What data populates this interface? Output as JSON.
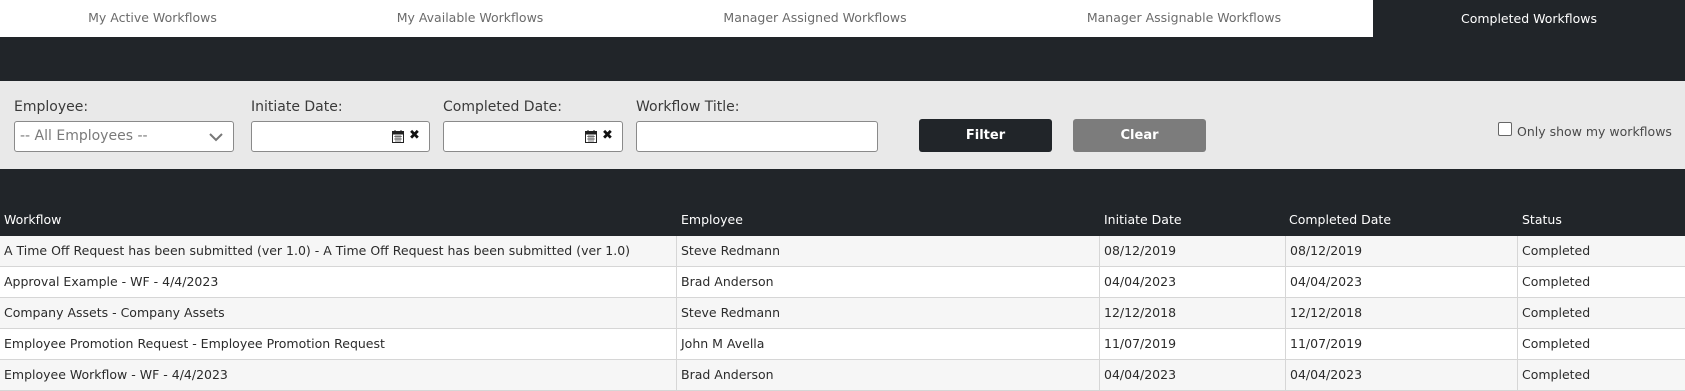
{
  "tabs": [
    {
      "label": "My Active Workflows"
    },
    {
      "label": "My Available Workflows"
    },
    {
      "label": "Manager Assigned Workflows"
    },
    {
      "label": "Manager Assignable Workflows"
    },
    {
      "label": "Completed Workflows",
      "active": true
    }
  ],
  "filters": {
    "employee_label": "Employee:",
    "employee_value": "-- All Employees --",
    "initiate_label": "Initiate Date:",
    "completed_label": "Completed Date:",
    "title_label": "Workflow Title:",
    "filter_button": "Filter",
    "clear_button": "Clear",
    "only_mine_label": "Only show my workflows",
    "only_mine_checked": false
  },
  "table": {
    "headers": [
      "Workflow",
      "Employee",
      "Initiate Date",
      "Completed Date",
      "Status"
    ],
    "rows": [
      [
        "A Time Off Request has been submitted (ver 1.0) - A Time Off Request has been submitted (ver 1.0)",
        "Steve Redmann",
        "08/12/2019",
        "08/12/2019",
        "Completed"
      ],
      [
        "Approval Example - WF - 4/4/2023",
        "Brad Anderson",
        "04/04/2023",
        "04/04/2023",
        "Completed"
      ],
      [
        "Company Assets - Company Assets",
        "Steve Redmann",
        "12/12/2018",
        "12/12/2018",
        "Completed"
      ],
      [
        "Employee Promotion Request - Employee Promotion Request",
        "John M Avella",
        "11/07/2019",
        "11/07/2019",
        "Completed"
      ],
      [
        "Employee Workflow - WF - 4/4/2023",
        "Brad Anderson",
        "04/04/2023",
        "04/04/2023",
        "Completed"
      ]
    ]
  },
  "colors": {
    "dark": "#212529",
    "filter_bg": "#e9e9e9",
    "clear_button": "#7c7c7c",
    "row_alt": "#f6f6f6"
  }
}
